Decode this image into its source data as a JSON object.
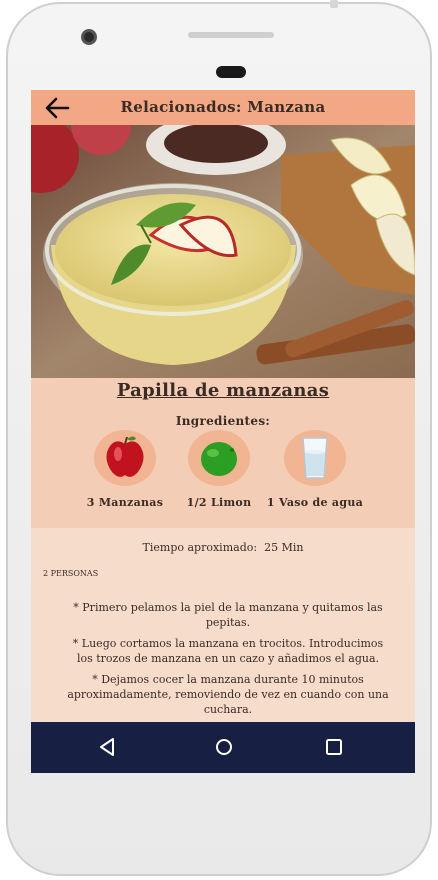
{
  "appbar": {
    "title": "Relacionados: Manzana"
  },
  "recipe": {
    "title": "Papilla de manzanas",
    "ingredients_label": "Ingredientes:",
    "ingredients": [
      {
        "label": "3 Manzanas",
        "icon": "apple-icon"
      },
      {
        "label": "1/2 Limon",
        "icon": "lime-icon"
      },
      {
        "label": "1 Vaso de agua",
        "icon": "water-glass-icon"
      }
    ],
    "time_label": "Tiempo aproximado:",
    "time_value": "25 Min",
    "persons": "2 PERSONAS",
    "steps": [
      "* Primero pelamos la piel de la manzana y quitamos las pepitas.",
      "* Luego cortamos la manzana en trocitos. Introducimos los trozos de manzana en un cazo y añadimos el agua.",
      "* Dejamos cocer la manzana durante 10 minutos aproximadamente, removiendo de vez en cuando con una cuchara."
    ]
  },
  "colors": {
    "appbar": "#f2a785",
    "background": "#f6dccb",
    "navbar": "#172043"
  }
}
